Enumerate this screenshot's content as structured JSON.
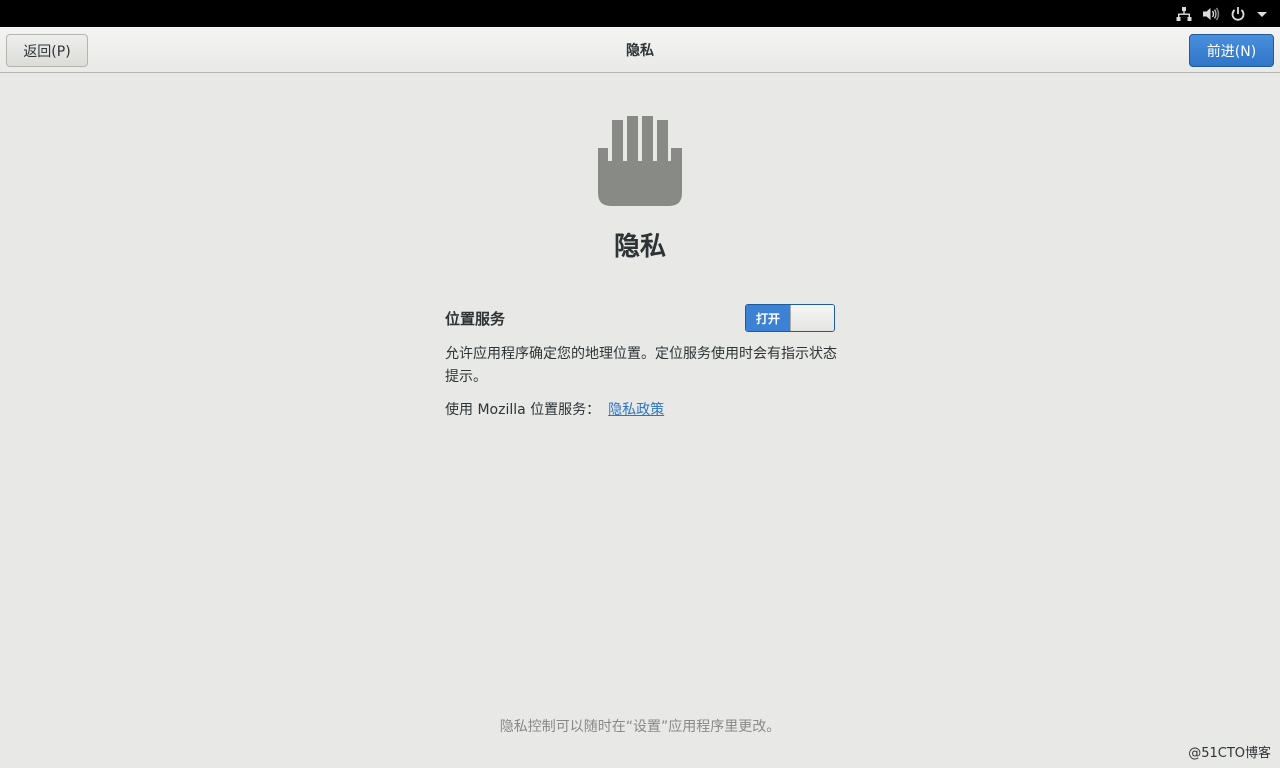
{
  "system_bar": {
    "icons": [
      "network-icon",
      "volume-icon",
      "power-icon",
      "dropdown-arrow-icon"
    ]
  },
  "header": {
    "back_label": "返回(P)",
    "title": "隐私",
    "next_label": "前进(N)"
  },
  "main": {
    "icon": "privacy-hand-icon",
    "heading": "隐私",
    "location_services": {
      "label": "位置服务",
      "toggle_state": "打开",
      "description": "允许应用程序确定您的地理位置。定位服务使用时会有指示状态提示。",
      "mozilla_text": "使用 Mozilla 位置服务：",
      "policy_link": "隐私政策"
    }
  },
  "footer": {
    "note": "隐私控制可以随时在“设置”应用程序里更改。"
  },
  "watermark": "@51CTO博客",
  "colors": {
    "accent": "#3b82d5",
    "link": "#2a76c6",
    "background": "#e8e8e7",
    "icon_gray": "#888a85"
  }
}
